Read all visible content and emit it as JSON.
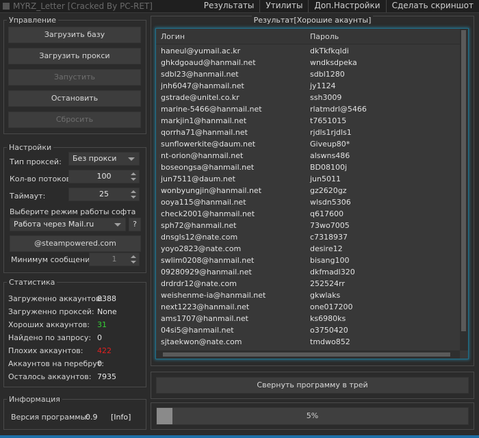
{
  "window": {
    "title": "MYRZ_Letter [Cracked By PC-RET]"
  },
  "menu": {
    "items": [
      "Результаты",
      "Утилиты",
      "Доп.Настройки",
      "Сделать скриншот"
    ]
  },
  "control": {
    "title": "Управление",
    "load_base": "Загрузить базу",
    "load_proxy": "Загрузить прокси",
    "start": "Запустить",
    "stop": "Остановить",
    "reset": "Сбросить"
  },
  "settings": {
    "title": "Настройки",
    "proxy_type_label": "Тип проксей:",
    "proxy_type_value": "Без прокси",
    "threads_label": "Кол-во потоков:",
    "threads_value": "100",
    "timeout_label": "Таймаут:",
    "timeout_value": "25",
    "mode_label": "Выберите режим работы софта",
    "mode_value": "Работа через Mail.ru",
    "help": "?",
    "domain_button": "@steampowered.com",
    "min_messages_label": "Минимум сообщений:",
    "min_messages_value": "1"
  },
  "stats": {
    "title": "Статистика",
    "items": [
      {
        "label": "Загруженно аккаунтов:",
        "value": "8388",
        "color": "#e6e6e6"
      },
      {
        "label": "Загруженно проксей:",
        "value": "None",
        "color": "#e6e6e6"
      },
      {
        "label": "Хороших аккаунтов:",
        "value": "31",
        "color": "#35d235"
      },
      {
        "label": "Найдено по запросу:",
        "value": "0",
        "color": "#e6e6e6"
      },
      {
        "label": "Плохих аккаунтов:",
        "value": "422",
        "color": "#e02020"
      },
      {
        "label": "Аккаунтов на перебрут:",
        "value": "0",
        "color": "#e6e6e6"
      },
      {
        "label": "Осталось аккаунтов:",
        "value": "7935",
        "color": "#e6e6e6"
      }
    ]
  },
  "info": {
    "title": "Информация",
    "version_label": "Версия программы:",
    "version_value": "0.9",
    "info_link": "[Info]"
  },
  "results": {
    "title": "Результат[Хорошие акаунты]",
    "col_login": "Логин",
    "col_password": "Пароль",
    "rows": [
      [
        "haneul@yumail.ac.kr",
        "dkTkfkqldi"
      ],
      [
        "ghkdgoaud@hanmail.net",
        "wndksdpeka"
      ],
      [
        "sdbl23@hanmail.net",
        "sdbl1280"
      ],
      [
        "jnh6047@hanmail.net",
        "jy1124"
      ],
      [
        "gstrade@unitel.co.kr",
        "ssh3009"
      ],
      [
        "marine-5466@hanmail.net",
        "rlatmdrl@5466"
      ],
      [
        "markjin1@hanmail.net",
        "t7651015"
      ],
      [
        "qorrha71@hanmail.net",
        "rjdls1rjdls1"
      ],
      [
        "sunflowerkite@daum.net",
        "Giveup80*"
      ],
      [
        "nt-orion@hanmail.net",
        "alswns486"
      ],
      [
        "boseongsa@hanmail.net",
        "BD08100j"
      ],
      [
        "jun7511@daum.net",
        "jun5011"
      ],
      [
        "wonbyungjin@hanmail.net",
        "gz2620gz"
      ],
      [
        "ooya115@hanmail.net",
        "wlsdn5306"
      ],
      [
        "check2001@hanmail.net",
        "q617600"
      ],
      [
        "sph72@hanmail.net",
        "73wo7005"
      ],
      [
        "dnsgls12@nate.com",
        "c7318937"
      ],
      [
        "yoyo2823@nate.com",
        "desire12"
      ],
      [
        "swlim0208@hanmail.net",
        "bisang100"
      ],
      [
        "09280929@hanmail.net",
        "dkfmadl320"
      ],
      [
        "drdrdr12@nate.com",
        "252524rr"
      ],
      [
        "weishenme-ia@hanmail.net",
        "gkwlaks"
      ],
      [
        "next1223@hanmail.net",
        "one017200"
      ],
      [
        "ams1707@hanmail.net",
        "ks6980ks"
      ],
      [
        "04si5@hanmail.net",
        "o3750420"
      ],
      [
        "sjtaekwon@nate.com",
        "tmdwo852"
      ]
    ]
  },
  "tray_button": "Свернуть программу в трей",
  "progress": {
    "percent": 5,
    "label": "5%"
  }
}
